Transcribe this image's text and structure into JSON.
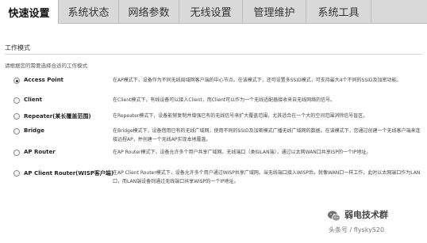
{
  "tabs": [
    {
      "label": "快速设置",
      "active": true
    },
    {
      "label": "系统状态",
      "active": false
    },
    {
      "label": "网络参数",
      "active": false
    },
    {
      "label": "无线设置",
      "active": false
    },
    {
      "label": "管理维护",
      "active": false
    },
    {
      "label": "系统工具",
      "active": false
    }
  ],
  "section": {
    "title": "工作模式",
    "instruction": "请根据您的需要选择合适的工作模式"
  },
  "modes": [
    {
      "label": "Access Point",
      "checked": true,
      "description": "在AP模式下，设备作为不同无线局域网客户端的中心节点。在该模式下，还可设置多SSID模式，可支持最大4个不同的SSID及加密功能。"
    },
    {
      "label": "Client",
      "checked": false,
      "description": "在Client模式下，有线设备可以接入Client，而Client可以作为一个无线适配器接收来自无线网络的信号。"
    },
    {
      "label": "Repeater(某长覆盖范围)",
      "checked": false,
      "description": "在Repeater模式下，设备能够复制并增强已有的无线信号来扩大覆盖范围，尤其适合在一个大的空间范围消除信号盲区。"
    },
    {
      "label": "Bridge",
      "checked": false,
      "description": "在Bridge模式下，设备借用已有的无线广域网，使用不同的SSID及加密模式广播无线广域网的数据。在该模式下，您通过创建一个无线客户端来连接远程AP，并创建一个无线AP实现本地覆盖。"
    },
    {
      "label": "AP Router",
      "checked": false,
      "description": "在AP Router模式下，设备允许多个用户共享广域网。无线端口（类似LAN端），通过以太网WAN口共享ISP的一个IP地址。"
    },
    {
      "label": "AP Client Router(WISP客户端)",
      "checked": false,
      "description": "在AP Client Router模式下，设备允许多个用户通过WISP共享广域网。当无线端口接入WISP后，就像WAN口一样工作，此时以太网端口作为LAN口，而LAN端设备则通过无线端口共享WISP的一个IP地址。"
    }
  ],
  "watermark": {
    "name": "弱电技术群",
    "account": "头条号 / flysky520"
  },
  "colors": {
    "tab_bar": "#d9d9d9",
    "active_tab": "#ffffff",
    "divider": "#d8d8d8"
  }
}
